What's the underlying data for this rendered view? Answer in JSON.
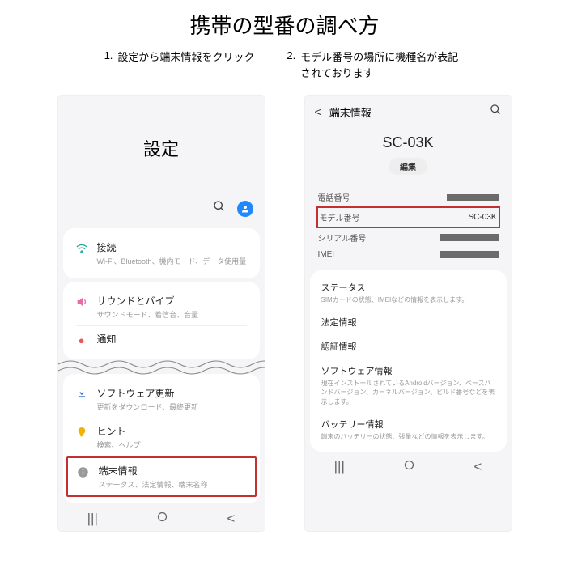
{
  "title": "携帯の型番の調べ方",
  "steps": [
    {
      "num": "1.",
      "text": "設定から端末情報をクリック"
    },
    {
      "num": "2.",
      "text": "モデル番号の場所に機種名が表記されております"
    }
  ],
  "phone1": {
    "header": "設定",
    "rows": {
      "connections": {
        "title": "接続",
        "sub": "Wi-Fi、Bluetooth、機内モード、データ使用量"
      },
      "sound": {
        "title": "サウンドとバイブ",
        "sub": "サウンドモード、着信音、音量"
      },
      "notif": {
        "title": "通知"
      },
      "software": {
        "title": "ソフトウェア更新",
        "sub": "更新をダウンロード、最終更新"
      },
      "hint": {
        "title": "ヒント",
        "sub": "検索、ヘルプ"
      },
      "device": {
        "title": "端末情報",
        "sub": "ステータス、法定情報、端末名称"
      }
    }
  },
  "phone2": {
    "header": "端末情報",
    "model": "SC-03K",
    "edit": "編集",
    "info": {
      "phone": "電話番号",
      "modelnum_label": "モデル番号",
      "modelnum_value": "SC-03K",
      "serial": "シリアル番号",
      "imei": "IMEI"
    },
    "sections": {
      "status": {
        "title": "ステータス",
        "sub": "SIMカードの状態、IMEIなどの情報を表示します。"
      },
      "legal": {
        "title": "法定情報"
      },
      "cert": {
        "title": "認証情報"
      },
      "sw": {
        "title": "ソフトウェア情報",
        "sub": "現在インストールされているAndroidバージョン、ベースバンドバージョン、カーネルバージョン、ビルド番号などを表示します。"
      },
      "battery": {
        "title": "バッテリー情報",
        "sub": "端末のバッテリーの状態、残量などの情報を表示します。"
      }
    }
  }
}
